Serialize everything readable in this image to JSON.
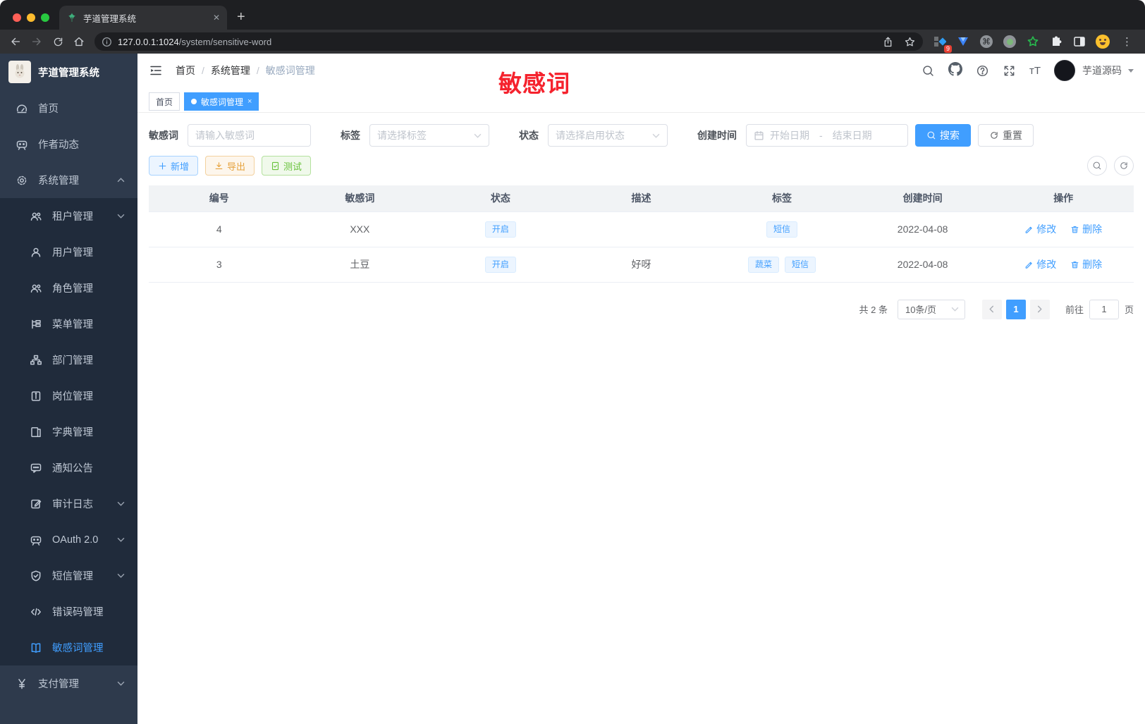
{
  "colors": {
    "accent": "#409eff",
    "annotation_red": "#f5222d",
    "sidebar_bg": "#2e3a4c",
    "submenu_bg": "#202b3b",
    "tag_bg": "#ecf5ff"
  },
  "browser": {
    "tab_title": "芋道管理系统",
    "close_glyph": "✕",
    "new_tab_glyph": "+",
    "url_host": "127.0.0.1:1024",
    "url_path": "/system/sensitive-word",
    "extension_badge": "9",
    "menu_glyph": "⋮"
  },
  "sidebar": {
    "app_title": "芋道管理系统",
    "items": [
      {
        "label": "首页"
      },
      {
        "label": "作者动态"
      },
      {
        "label": "系统管理"
      },
      {
        "label": "租户管理"
      },
      {
        "label": "用户管理"
      },
      {
        "label": "角色管理"
      },
      {
        "label": "菜单管理"
      },
      {
        "label": "部门管理"
      },
      {
        "label": "岗位管理"
      },
      {
        "label": "字典管理"
      },
      {
        "label": "通知公告"
      },
      {
        "label": "审计日志"
      },
      {
        "label": "OAuth 2.0"
      },
      {
        "label": "短信管理"
      },
      {
        "label": "错误码管理"
      },
      {
        "label": "敏感词管理"
      },
      {
        "label": "支付管理"
      }
    ]
  },
  "header": {
    "breadcrumb": [
      "首页",
      "系统管理",
      "敏感词管理"
    ],
    "separator": "/",
    "annotation": "敏感词",
    "font_icon_text": "тT",
    "user_name": "芋道源码"
  },
  "tabs_bar": {
    "tabs": [
      {
        "label": "首页"
      },
      {
        "label": "敏感词管理"
      }
    ],
    "close_glyph": "×"
  },
  "filters": {
    "word_label": "敏感词",
    "word_placeholder": "请输入敏感词",
    "tag_label": "标签",
    "tag_placeholder": "请选择标签",
    "status_label": "状态",
    "status_placeholder": "请选择启用状态",
    "date_label": "创建时间",
    "date_start": "开始日期",
    "date_separator": "-",
    "date_end": "结束日期",
    "search_label": "搜索",
    "reset_label": "重置"
  },
  "toolbar": {
    "add_label": "新增",
    "export_label": "导出",
    "test_label": "测试"
  },
  "table": {
    "columns": [
      "编号",
      "敏感词",
      "状态",
      "描述",
      "标签",
      "创建时间",
      "操作"
    ],
    "edit_label": "修改",
    "delete_label": "删除",
    "rows": [
      {
        "id": "4",
        "word": "XXX",
        "status": "开启",
        "desc": "",
        "tags": [
          "短信"
        ],
        "created": "2022-04-08"
      },
      {
        "id": "3",
        "word": "土豆",
        "status": "开启",
        "desc": "好呀",
        "tags": [
          "蔬菜",
          "短信"
        ],
        "created": "2022-04-08"
      }
    ]
  },
  "pagination": {
    "total": "共 2 条",
    "page_size": "10条/页",
    "page": "1",
    "goto_label": "前往",
    "goto_value": "1",
    "page_unit": "页"
  }
}
